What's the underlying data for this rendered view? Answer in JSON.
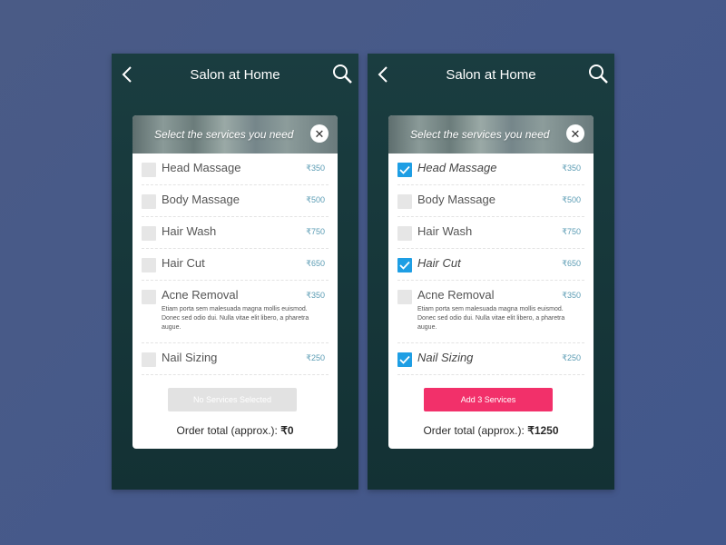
{
  "screens": [
    {
      "nav_title": "Salon at Home",
      "modal_title": "Select the services you need",
      "close_glyph": "✕",
      "services": [
        {
          "name": "Head Massage",
          "price": "₹350",
          "checked": false
        },
        {
          "name": "Body Massage",
          "price": "₹500",
          "checked": false
        },
        {
          "name": "Hair Wash",
          "price": "₹750",
          "checked": false
        },
        {
          "name": "Hair Cut",
          "price": "₹650",
          "checked": false
        },
        {
          "name": "Acne Removal",
          "price": "₹350",
          "checked": false,
          "description": "Etiam porta sem malesuada magna mollis euismod. Donec sed odio dui. Nulla vitae elit libero, a pharetra augue."
        },
        {
          "name": "Nail Sizing",
          "price": "₹250",
          "checked": false
        }
      ],
      "button_label": "No Services Selected",
      "button_state": "disabled",
      "total_label": "Order total (approx.):",
      "total_value": "₹0"
    },
    {
      "nav_title": "Salon at Home",
      "modal_title": "Select the services you need",
      "close_glyph": "✕",
      "services": [
        {
          "name": "Head Massage",
          "price": "₹350",
          "checked": true
        },
        {
          "name": "Body Massage",
          "price": "₹500",
          "checked": false
        },
        {
          "name": "Hair Wash",
          "price": "₹750",
          "checked": false
        },
        {
          "name": "Hair Cut",
          "price": "₹650",
          "checked": true
        },
        {
          "name": "Acne Removal",
          "price": "₹350",
          "checked": false,
          "description": "Etiam porta sem malesuada magna mollis euismod. Donec sed odio dui. Nulla vitae elit libero, a pharetra augue."
        },
        {
          "name": "Nail Sizing",
          "price": "₹250",
          "checked": true
        }
      ],
      "button_label": "Add 3 Services",
      "button_state": "active",
      "total_label": "Order total (approx.):",
      "total_value": "₹1250"
    }
  ],
  "colors": {
    "accent": "#1e9ee4",
    "cta": "#f2306a",
    "price": "#5b9cb4",
    "nav_bg": "#1a3d40"
  },
  "icons": {
    "back": "chevron-left-icon",
    "search": "search-icon",
    "close": "close-icon",
    "check": "check-icon"
  }
}
